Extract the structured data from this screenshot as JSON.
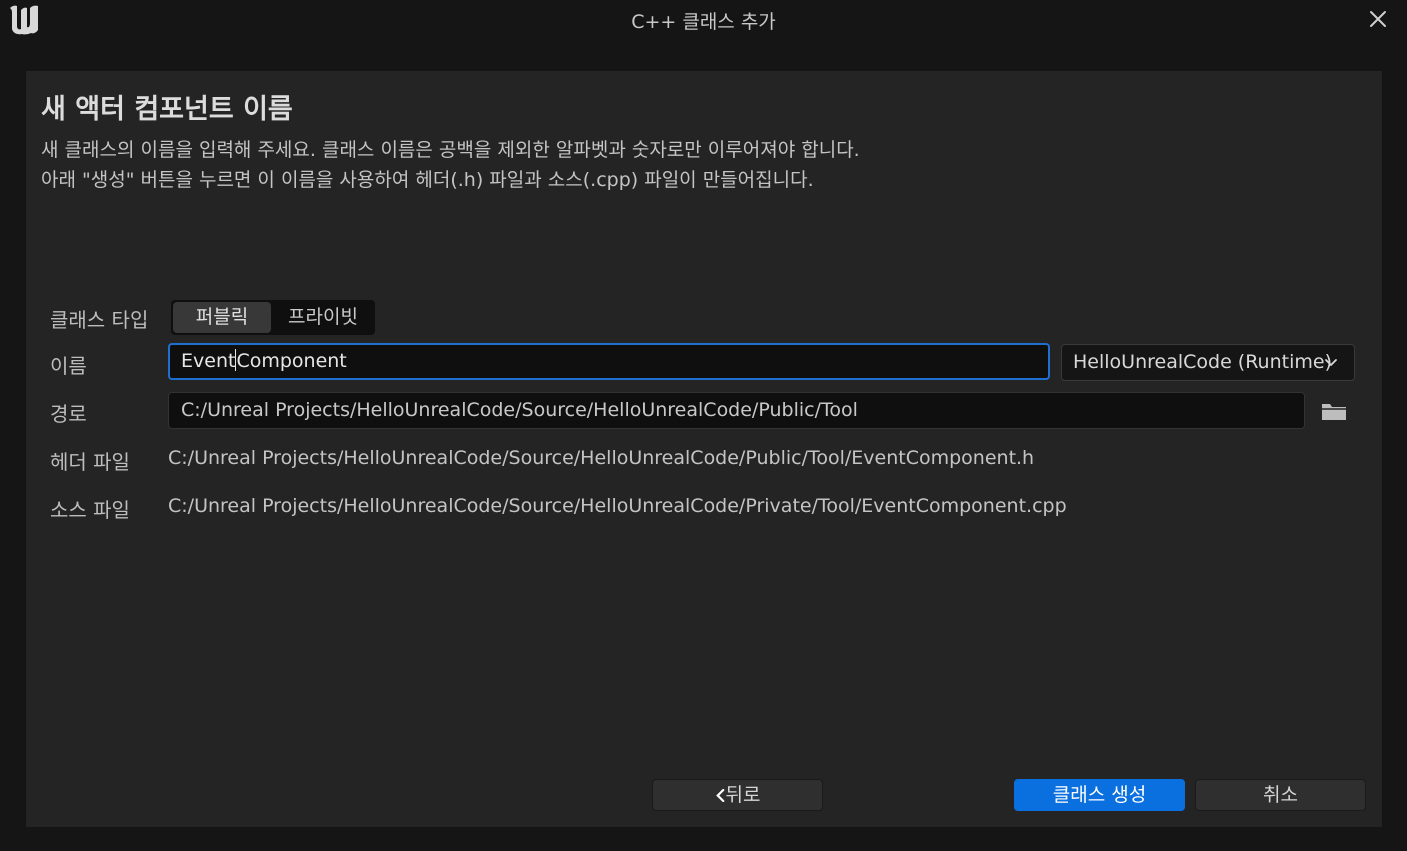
{
  "window": {
    "title": "C++ 클래스 추가",
    "logo_icon": "unreal-logo-icon",
    "close_icon": "close-icon"
  },
  "page": {
    "heading": "새 액터 컴포넌트 이름",
    "description_line1": "새 클래스의 이름을 입력해 주세요. 클래스 이름은 공백을 제외한 알파벳과 숫자로만 이루어져야 합니다.",
    "description_line2": "아래 \"생성\" 버튼을 누르면 이 이름을 사용하여 헤더(.h) 파일과 소스(.cpp) 파일이 만들어집니다."
  },
  "form": {
    "class_type_label": "클래스 타입",
    "class_type_options": [
      "퍼블릭",
      "프라이빗"
    ],
    "class_type_selected": "퍼블릭",
    "name_label": "이름",
    "name_value_before_caret": "Event",
    "name_value_after_caret": "Component",
    "module_value": "HelloUnrealCode (Runtime)",
    "path_label": "경로",
    "path_value": "C:/Unreal Projects/HelloUnrealCode/Source/HelloUnrealCode/Public/Tool",
    "header_label": "헤더 파일",
    "header_value": "C:/Unreal Projects/HelloUnrealCode/Source/HelloUnrealCode/Public/Tool/EventComponent.h",
    "source_label": "소스 파일",
    "source_value": "C:/Unreal Projects/HelloUnrealCode/Source/HelloUnrealCode/Private/Tool/EventComponent.cpp"
  },
  "buttons": {
    "back_label": "뒤로",
    "create_label": "클래스 생성",
    "cancel_label": "취소"
  },
  "colors": {
    "accent": "#0a70e0",
    "focus_border": "#1f6fd1",
    "panel_bg": "#242424",
    "window_bg": "#151515"
  }
}
